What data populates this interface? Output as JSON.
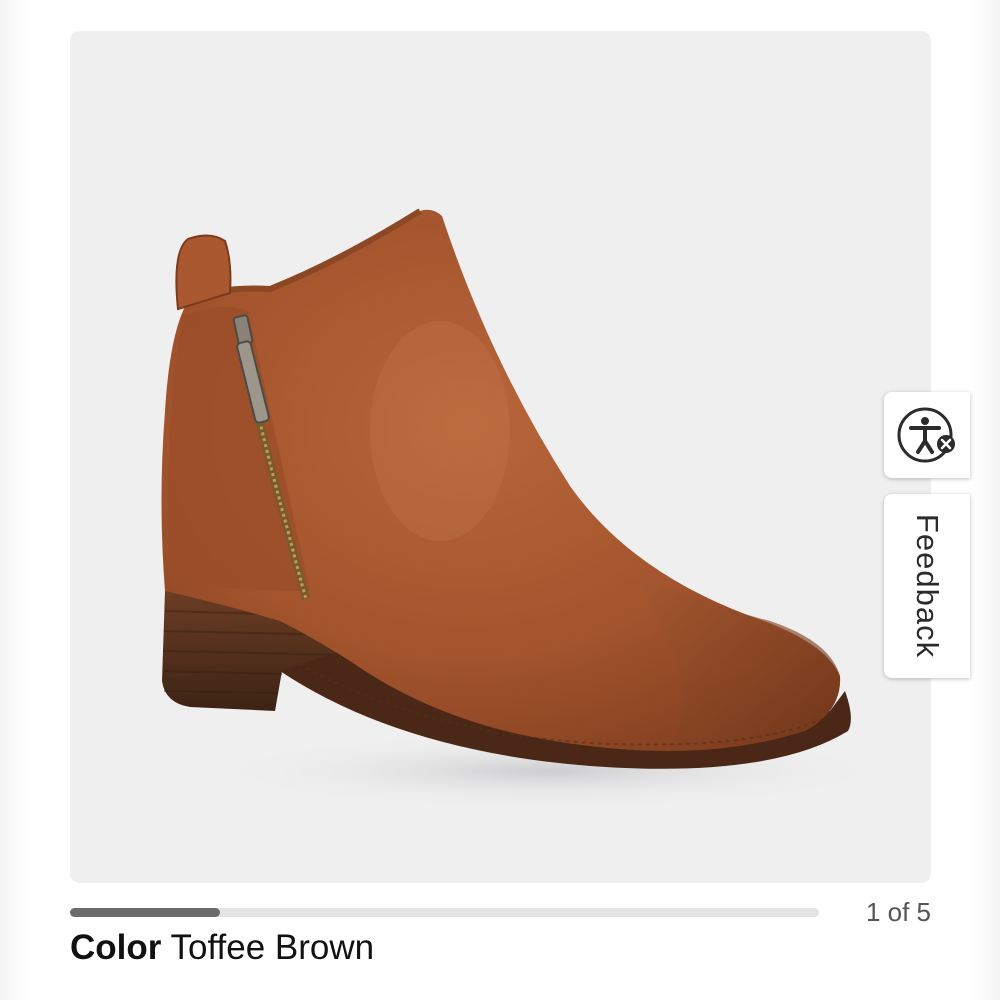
{
  "product_image": {
    "alt": "Toffee Brown leather ankle bootie with side zipper and stacked heel"
  },
  "gallery": {
    "current": 1,
    "total": 5,
    "counter_text": "1 of 5",
    "progress_fraction": 0.2
  },
  "color": {
    "label": "Color",
    "value": "Toffee Brown"
  },
  "side_tabs": {
    "accessibility_icon": "accessibility-icon",
    "feedback_label": "Feedback"
  },
  "colors": {
    "image_background": "#efeff0",
    "progress_fill": "#6b6b6b",
    "progress_track": "#e4e4e4",
    "leather": "#a4552d"
  }
}
